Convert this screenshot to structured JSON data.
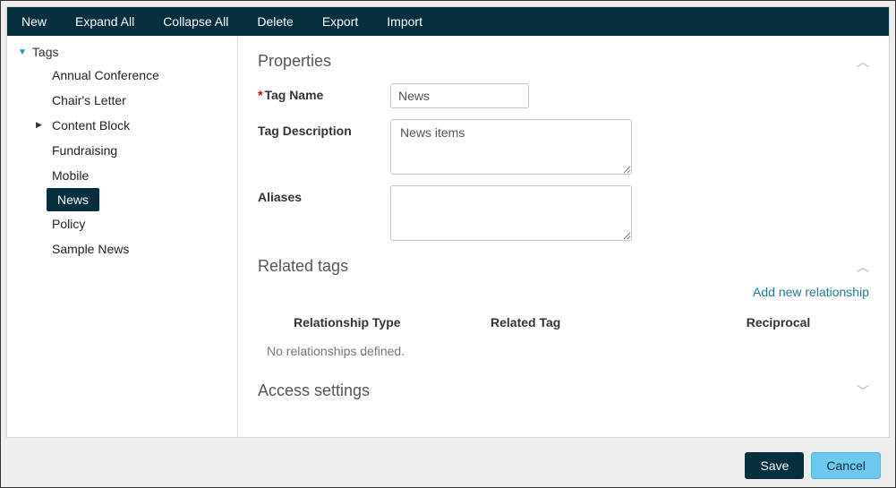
{
  "toolbar": {
    "new": "New",
    "expand_all": "Expand All",
    "collapse_all": "Collapse All",
    "delete": "Delete",
    "export": "Export",
    "import": "Import"
  },
  "tree": {
    "root": "Tags",
    "items": [
      {
        "label": "Annual Conference",
        "has_children": false,
        "selected": false
      },
      {
        "label": "Chair's Letter",
        "has_children": false,
        "selected": false
      },
      {
        "label": "Content Block",
        "has_children": true,
        "selected": false
      },
      {
        "label": "Fundraising",
        "has_children": false,
        "selected": false
      },
      {
        "label": "Mobile",
        "has_children": false,
        "selected": false
      },
      {
        "label": "News",
        "has_children": false,
        "selected": true
      },
      {
        "label": "Policy",
        "has_children": false,
        "selected": false
      },
      {
        "label": "Sample News",
        "has_children": false,
        "selected": false
      }
    ]
  },
  "properties": {
    "heading": "Properties",
    "tag_name_label": "Tag Name",
    "tag_name_value": "News",
    "tag_desc_label": "Tag Description",
    "tag_desc_value": "News items",
    "aliases_label": "Aliases",
    "aliases_value": ""
  },
  "related": {
    "heading": "Related tags",
    "add_link": "Add new relationship",
    "col1": "Relationship Type",
    "col2": "Related Tag",
    "col3": "Reciprocal",
    "empty": "No relationships defined."
  },
  "access": {
    "heading": "Access settings"
  },
  "buttons": {
    "save": "Save",
    "cancel": "Cancel"
  }
}
